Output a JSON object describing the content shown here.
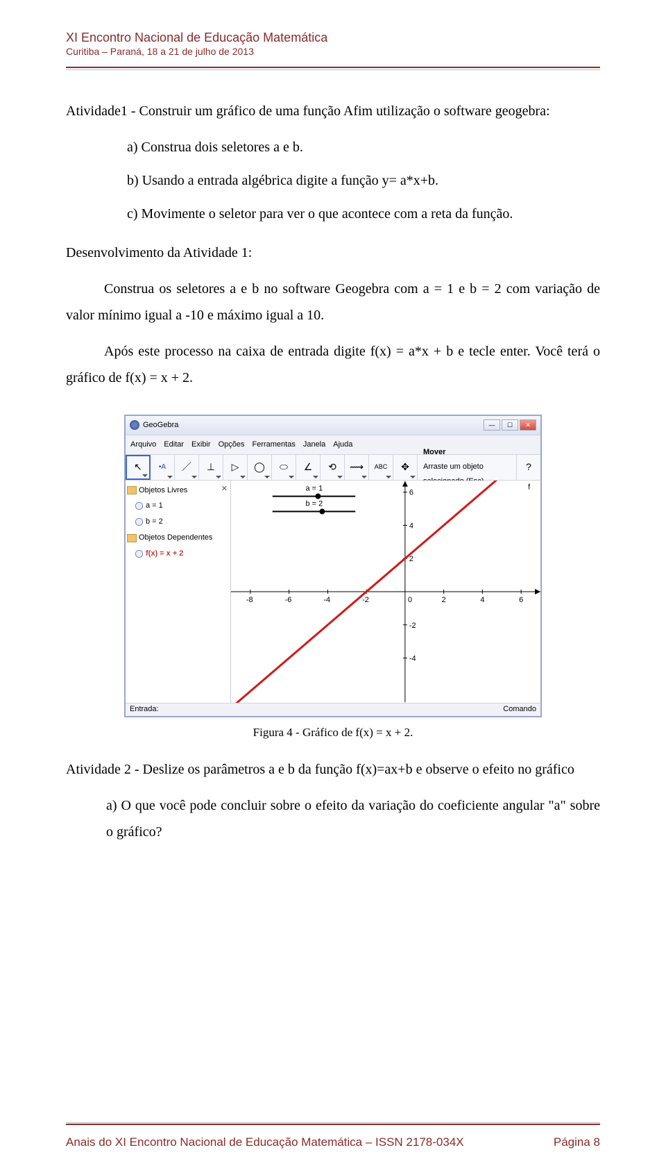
{
  "header": {
    "title": "XI Encontro Nacional de Educação Matemática",
    "subtitle": "Curitiba – Paraná, 18 a 21 de julho de 2013"
  },
  "text": {
    "activity1_intro": "Atividade1 - Construir um gráfico de uma função Afim utilização o software geogebra:",
    "a1_a": "a) Construa dois seletores a e b.",
    "a1_b": "b) Usando a entrada algébrica digite a função y= a*x+b.",
    "a1_c": "c) Movimente o seletor para ver o que acontece com a reta da função.",
    "dev1_title": "Desenvolvimento da Atividade 1:",
    "dev1_p1": "Construa os seletores a e b no software Geogebra com a = 1 e b = 2 com variação de valor mínimo igual a -10 e máximo igual a 10.",
    "dev1_p2": "Após este processo na caixa de entrada digite f(x) = a*x + b e tecle enter. Você terá o gráfico de f(x) = x + 2.",
    "fig_caption": "Figura 4 - Gráfico de f(x) = x + 2.",
    "activity2": "Atividade 2 - Deslize os parâmetros a e b da função f(x)=ax+b e observe o efeito no gráfico",
    "a2_a": "a) O que você pode concluir sobre o efeito da variação do coeficiente angular \"a\" sobre o gráfico?"
  },
  "geogebra": {
    "window_title": "GeoGebra",
    "menus": [
      "Arquivo",
      "Editar",
      "Exibir",
      "Opções",
      "Ferramentas",
      "Janela",
      "Ajuda"
    ],
    "tool_help_title": "Mover",
    "tool_help_sub": "Arraste um objeto selecionado (Esc)",
    "tree": {
      "free_label": "Objetos Livres",
      "a_item": "a = 1",
      "b_item": "b = 2",
      "dep_label": "Objetos Dependentes",
      "fx_item": "f(x) = x + 2"
    },
    "sliders": {
      "a_label": "a = 1",
      "b_label": "b = 2"
    },
    "bottom_left": "Entrada:",
    "bottom_right": "Comando"
  },
  "chart_data": {
    "type": "line",
    "title": "f(x) = x + 2",
    "xlabel": "",
    "ylabel": "",
    "xlim": [
      -9,
      7
    ],
    "ylim": [
      -5,
      7
    ],
    "x_ticks": [
      -8,
      -6,
      -4,
      -2,
      0,
      2,
      4,
      6
    ],
    "y_ticks": [
      -4,
      -2,
      0,
      2,
      4,
      6
    ],
    "series": [
      {
        "name": "f(x)=x+2",
        "color": "#d01a1a",
        "x": [
          -8,
          -6,
          -4,
          -2,
          0,
          2,
          4,
          6
        ],
        "y": [
          -6,
          -4,
          -2,
          0,
          2,
          4,
          6,
          8
        ]
      }
    ],
    "sliders": [
      {
        "name": "a",
        "value": 1,
        "min": -10,
        "max": 10
      },
      {
        "name": "b",
        "value": 2,
        "min": -10,
        "max": 10
      }
    ]
  },
  "footer": {
    "left": "Anais do XI Encontro Nacional de Educação Matemática – ISSN 2178-034X",
    "right": "Página 8"
  }
}
